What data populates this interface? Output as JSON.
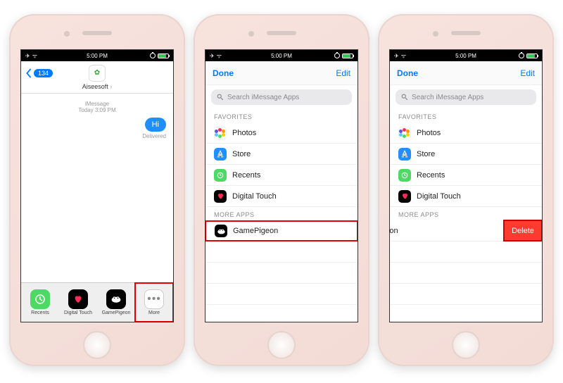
{
  "status": {
    "time": "5:00 PM",
    "carrier_dots": "••••"
  },
  "screen1": {
    "back_count": "134",
    "contact": "Aiseesoft",
    "thread_meta": "iMessage\nToday 3:09 PM",
    "bubble": "Hi",
    "delivered": "Delivered",
    "drawer": {
      "recents": "Recents",
      "digital_touch": "Digital Touch",
      "gamepigeon": "GamePigeon",
      "more": "More"
    }
  },
  "list": {
    "done": "Done",
    "edit": "Edit",
    "search_placeholder": "Search iMessage Apps",
    "favorites_h": "FAVORITES",
    "more_h": "MORE APPS",
    "photos": "Photos",
    "store": "Store",
    "recents": "Recents",
    "digital_touch": "Digital Touch",
    "gamepigeon": "GamePigeon"
  },
  "screen3": {
    "swiped_label": "amePigeon",
    "delete": "Delete"
  }
}
